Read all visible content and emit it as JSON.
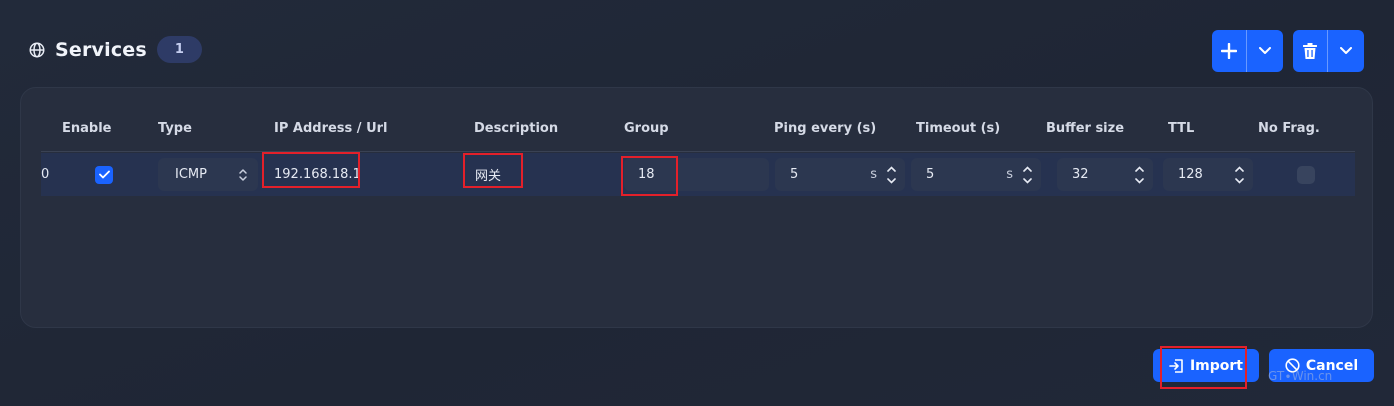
{
  "header": {
    "title": "Services",
    "count": "1"
  },
  "toolbar": {
    "add_icon": "plus-icon",
    "delete_icon": "trash-icon",
    "dropdown_icon": "chevron-down-icon"
  },
  "table": {
    "columns": [
      "Enable",
      "Type",
      "IP Address / Url",
      "Description",
      "Group",
      "Ping every (s)",
      "Timeout (s)",
      "Buffer size",
      "TTL",
      "No Frag."
    ],
    "rows": [
      {
        "index": "0",
        "enabled": true,
        "type": "ICMP",
        "ip": "192.168.18.1",
        "description": "网关",
        "group": "18",
        "ping_every": "5",
        "ping_unit": "s",
        "timeout": "5",
        "timeout_unit": "s",
        "buffer_size": "32",
        "ttl": "128",
        "no_frag": false
      }
    ]
  },
  "footer": {
    "import_label": "Import",
    "cancel_label": "Cancel"
  },
  "watermark": "GT∙Win.cn",
  "colors": {
    "accent": "#1a63ff",
    "background": "#222a3a",
    "panel": "#272e3e",
    "row": "#263250",
    "highlight": "#e3202a"
  }
}
